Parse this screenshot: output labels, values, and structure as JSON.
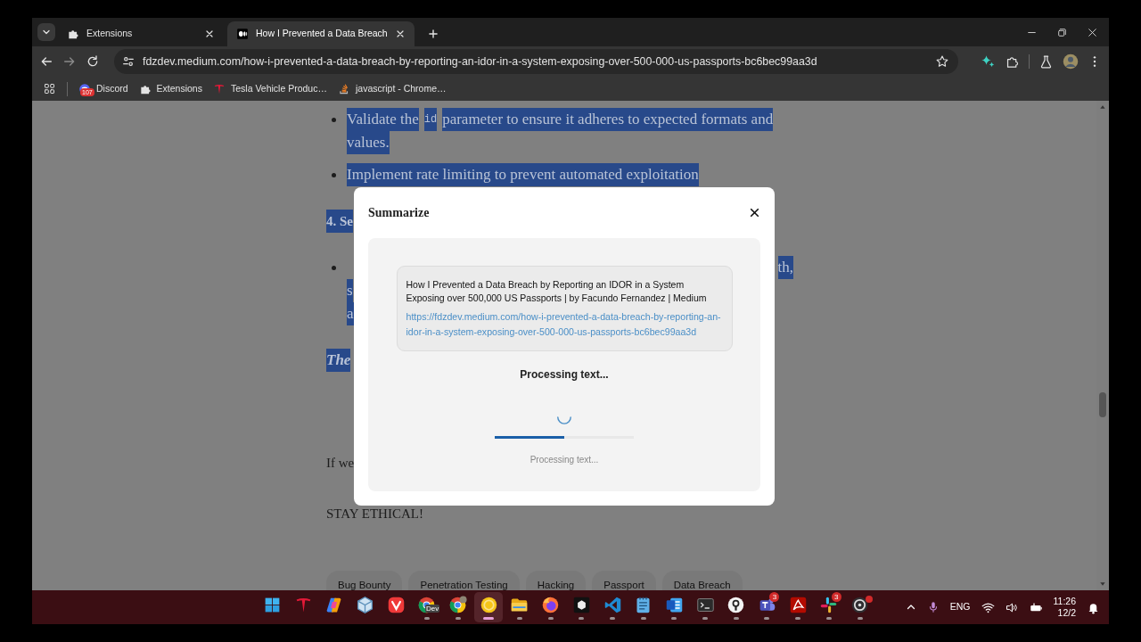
{
  "tabs": [
    {
      "label": "Extensions",
      "selected": false,
      "kind": "puzzle"
    },
    {
      "label": "How I Prevented a Data Breach",
      "selected": true,
      "kind": "medium"
    }
  ],
  "address_bar": {
    "url": "fdzdev.medium.com/how-i-prevented-a-data-breach-by-reporting-an-idor-in-a-system-exposing-over-500-000-us-passports-bc6bec99aa3d"
  },
  "bookmarks": [
    {
      "label": "Discord",
      "kind": "discord",
      "badge": "107"
    },
    {
      "label": "Extensions",
      "kind": "puzzle"
    },
    {
      "label": "Tesla Vehicle Produc…",
      "kind": "tesla"
    },
    {
      "label": "javascript - Chrome…",
      "kind": "stack"
    }
  ],
  "article": {
    "blocks": [
      {
        "kind": "bullet",
        "highlighted": true,
        "lines": [
          {
            "segments": [
              {
                "text": "Validate the",
                "code": false
              },
              {
                "text": "id",
                "code": true
              },
              {
                "text": "parameter to ensure it adheres to expected formats and",
                "code": false
              }
            ]
          },
          {
            "segments": [
              {
                "text": "values.",
                "code": false
              }
            ]
          }
        ]
      },
      {
        "kind": "bullet",
        "highlighted": true,
        "lines": [
          {
            "segments": [
              {
                "text": "Implement rate limiting to prevent automated exploitation",
                "code": false
              }
            ]
          }
        ]
      },
      {
        "kind": "heading",
        "highlighted": true,
        "lines": [
          {
            "segments": [
              {
                "text": "4. Se",
                "code": false
              }
            ]
          }
        ]
      },
      {
        "kind": "bullet",
        "highlighted": true,
        "lines": [
          {
            "right": "th,"
          },
          {
            "segments": [
              {
                "text": "s",
                "code": false
              }
            ]
          },
          {
            "segments": [
              {
                "text": "a",
                "code": false
              }
            ]
          }
        ]
      },
      {
        "kind": "emphasis",
        "highlighted": true,
        "lines": [
          {
            "segments": [
              {
                "text": "The",
                "code": false
              }
            ]
          }
        ]
      },
      {
        "kind": "paragraph",
        "highlighted": false,
        "lines": [
          {
            "segments": [
              {
                "text": "If we",
                "code": false
              }
            ]
          }
        ]
      },
      {
        "kind": "paragraph",
        "highlighted": false,
        "lines": [
          {
            "segments": [
              {
                "text": "STAY ETHICAL!",
                "code": false
              }
            ]
          }
        ]
      }
    ],
    "tags": [
      "Bug Bounty",
      "Penetration Testing",
      "Hacking",
      "Passport",
      "Data Breach"
    ]
  },
  "modal": {
    "title": "Summarize",
    "page_title": "How I Prevented a Data Breach by Reporting an IDOR in a System Exposing over 500,000 US Passports | by Facundo Fernandez | Medium",
    "url": "https://fdzdev.medium.com/how-i-prevented-a-data-breach-by-reporting-an-idor-in-a-system-exposing-over-500-000-us-passports-bc6bec99aa3d",
    "status": "Processing text...",
    "progress": {
      "level": 0.5,
      "caption": "Processing text..."
    }
  },
  "taskbar": {
    "apps": [
      {
        "kind": "windows",
        "selected": false,
        "running": false
      },
      {
        "kind": "tesla",
        "selected": false,
        "running": false
      },
      {
        "kind": "copilot",
        "selected": false,
        "running": false
      },
      {
        "kind": "cube",
        "selected": false,
        "running": false
      },
      {
        "kind": "vivaldi",
        "selected": false,
        "running": false
      },
      {
        "kind": "chrome",
        "selected": false,
        "running": true,
        "label": "Dev"
      },
      {
        "kind": "chrome-profile",
        "selected": false,
        "running": true
      },
      {
        "kind": "yellow-ring",
        "selected": true,
        "running": true
      },
      {
        "kind": "folder",
        "selected": false,
        "running": true
      },
      {
        "kind": "firefox",
        "selected": false,
        "running": true
      },
      {
        "kind": "black-box",
        "selected": false,
        "running": true
      },
      {
        "kind": "vscode",
        "selected": false,
        "running": true
      },
      {
        "kind": "notepad",
        "selected": false,
        "running": true
      },
      {
        "kind": "word",
        "selected": false,
        "running": true
      },
      {
        "kind": "terminal",
        "selected": false,
        "running": true
      },
      {
        "kind": "keyhole",
        "selected": false,
        "running": true
      },
      {
        "kind": "teams",
        "selected": false,
        "running": true,
        "badge": "3"
      },
      {
        "kind": "acrobat",
        "selected": false,
        "running": true
      },
      {
        "kind": "slack",
        "selected": false,
        "running": true,
        "badge": "3"
      },
      {
        "kind": "obs",
        "selected": false,
        "running": true,
        "dot": true
      }
    ],
    "tray": {
      "language": "ENG",
      "time": "11:26",
      "date": "12/2"
    }
  }
}
